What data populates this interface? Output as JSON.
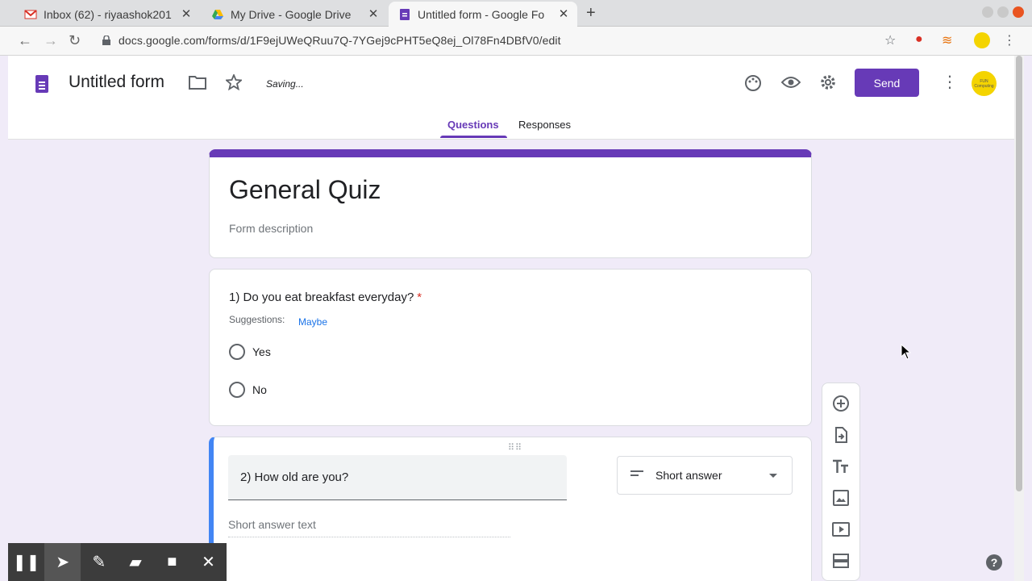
{
  "browser": {
    "tabs": [
      {
        "title": "Inbox (62) - riyaashok201",
        "icon": "gmail-icon"
      },
      {
        "title": "My Drive - Google Drive",
        "icon": "drive-icon"
      },
      {
        "title": "Untitled form - Google Fo",
        "icon": "forms-icon",
        "active": true
      }
    ],
    "url": "docs.google.com/forms/d/1F9ejUWeQRuu7Q-7YGej9cPHT5eQ8ej_Ol78Fn4DBfV0/edit"
  },
  "header": {
    "doc_title": "Untitled form",
    "status": "Saving...",
    "send_label": "Send",
    "avatar_text": "FUN Computing",
    "tabs": [
      {
        "label": "Questions",
        "active": true
      },
      {
        "label": "Responses",
        "active": false
      }
    ]
  },
  "form": {
    "title": "General Quiz",
    "description_placeholder": "Form description"
  },
  "questions": [
    {
      "text": "1) Do you eat breakfast everyday?",
      "required": "*",
      "suggestions_label": "Suggestions:",
      "suggestion": "Maybe",
      "options": [
        "Yes",
        "No"
      ]
    },
    {
      "text": "2) How old are you?",
      "type": "Short answer",
      "answer_placeholder": "Short answer text"
    }
  ],
  "colors": {
    "accent": "#673ab7",
    "background": "#f0ebf8",
    "focus": "#4285f4"
  },
  "side_toolbar": [
    "add-question-icon",
    "import-questions-icon",
    "add-title-icon",
    "add-image-icon",
    "add-video-icon",
    "add-section-icon"
  ],
  "recording_bar": [
    "pause-icon",
    "pointer-icon",
    "pen-icon",
    "highlighter-icon",
    "camera-icon",
    "close-icon"
  ]
}
